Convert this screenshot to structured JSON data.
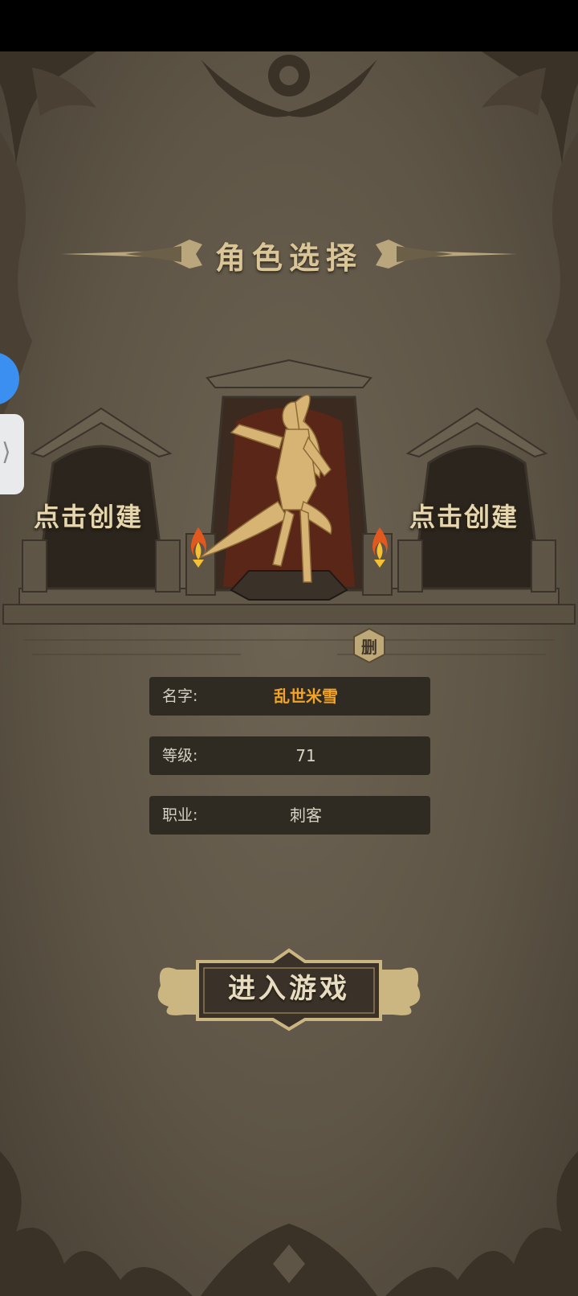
{
  "title": "角色选择",
  "slots": {
    "left": {
      "label": "点击创建"
    },
    "right": {
      "label": "点击创建"
    },
    "center": {
      "delete_label": "删"
    }
  },
  "character": {
    "name_label": "名字:",
    "name_value": "乱世米雪",
    "level_label": "等级:",
    "level_value": "71",
    "class_label": "职业:",
    "class_value": "刺客"
  },
  "enter_button": {
    "label": "进入游戏"
  },
  "colors": {
    "background": "#5e5546",
    "gold": "#d9c596",
    "name_highlight": "#f3a326",
    "info_panel": "#2f2a22",
    "floating_button": "#3a8ff0"
  },
  "icons": [
    "flame-torch-icon",
    "chevron-right-icon"
  ]
}
